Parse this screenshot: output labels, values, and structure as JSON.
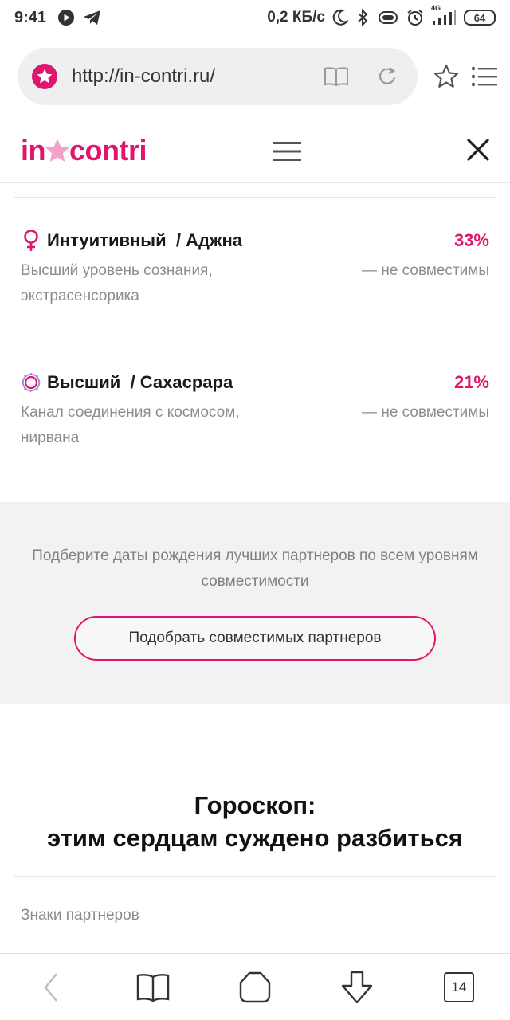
{
  "status_bar": {
    "time": "9:41",
    "network_speed": "0,2 КБ/с",
    "signal_label": "4G",
    "battery": "64"
  },
  "browser": {
    "url": "http://in-contri.ru/",
    "tab_count": "14"
  },
  "site": {
    "logo_left": "in",
    "logo_right": "contri",
    "brand_color": "#e0166e"
  },
  "levels": [
    {
      "icon": "venus-icon",
      "title": "Интуитивный",
      "subtitle": "/ Аджна",
      "percent": "33%",
      "description": "Высший уровень сознания, экстрасенсорика",
      "status": "— не совместимы"
    },
    {
      "icon": "sahasrara-icon",
      "title": "Высший",
      "subtitle": "/ Сахасрара",
      "percent": "21%",
      "description": "Канал соединения с космосом, нирвана",
      "status": "— не совместимы"
    }
  ],
  "cta": {
    "text": "Подберите даты рождения лучших партнеров по всем уровням совместимости",
    "button_label": "Подобрать совместимых партнеров"
  },
  "horoscope": {
    "title_line1": "Гороскоп:",
    "title_line2": "этим сердцам суждено разбиться",
    "signs_label": "Знаки партнеров"
  }
}
